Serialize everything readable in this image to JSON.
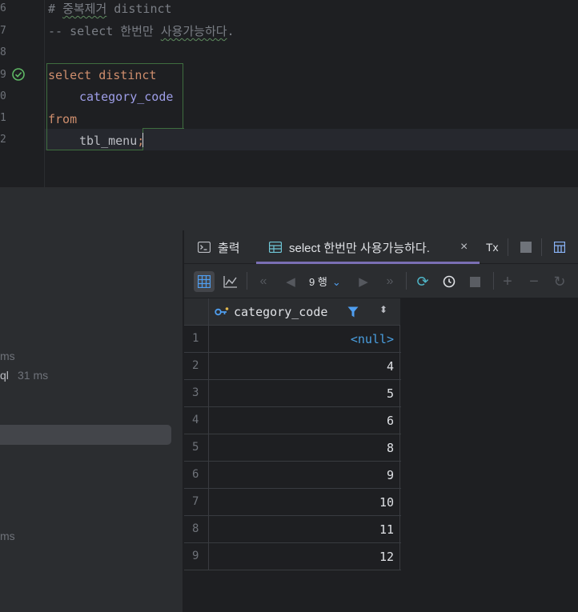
{
  "editor": {
    "line_numbers": [
      "6",
      "7",
      "8",
      "9",
      "0",
      "1",
      "2"
    ],
    "comment1_prefix": "# ",
    "comment1_korean": "중복제거",
    "comment1_rest": " distinct",
    "comment2_prefix": "-- select 한번만 ",
    "comment2_korean": "사용가능하다",
    "comment2_suffix": ".",
    "kw_select_distinct": "select distinct",
    "column_name": "category_code",
    "kw_from": "from",
    "table_name": "tbl_menu",
    "semicolon": ";"
  },
  "services_panel": {
    "timing1": "ms",
    "timing2_name": "ql",
    "timing2_value": "31 ms",
    "timing3": "ms"
  },
  "results": {
    "tab_output_label": "출력",
    "tab_result_label": "select 한번만 사용가능하다.",
    "tab_close_glyph": "×",
    "tx_label": "Tx",
    "rows_count_label": "9 행",
    "column_header": "category_code",
    "rows": [
      {
        "n": "1",
        "v": "<null>"
      },
      {
        "n": "2",
        "v": "4"
      },
      {
        "n": "3",
        "v": "5"
      },
      {
        "n": "4",
        "v": "6"
      },
      {
        "n": "5",
        "v": "8"
      },
      {
        "n": "6",
        "v": "9"
      },
      {
        "n": "7",
        "v": "10"
      },
      {
        "n": "8",
        "v": "11"
      },
      {
        "n": "9",
        "v": "12"
      }
    ]
  },
  "colors": {
    "accent": "#7a6fb4",
    "keyword": "#cf8e6d",
    "column": "#9e9ee8",
    "null_value": "#4a9fe0",
    "success": "#5fb865"
  }
}
